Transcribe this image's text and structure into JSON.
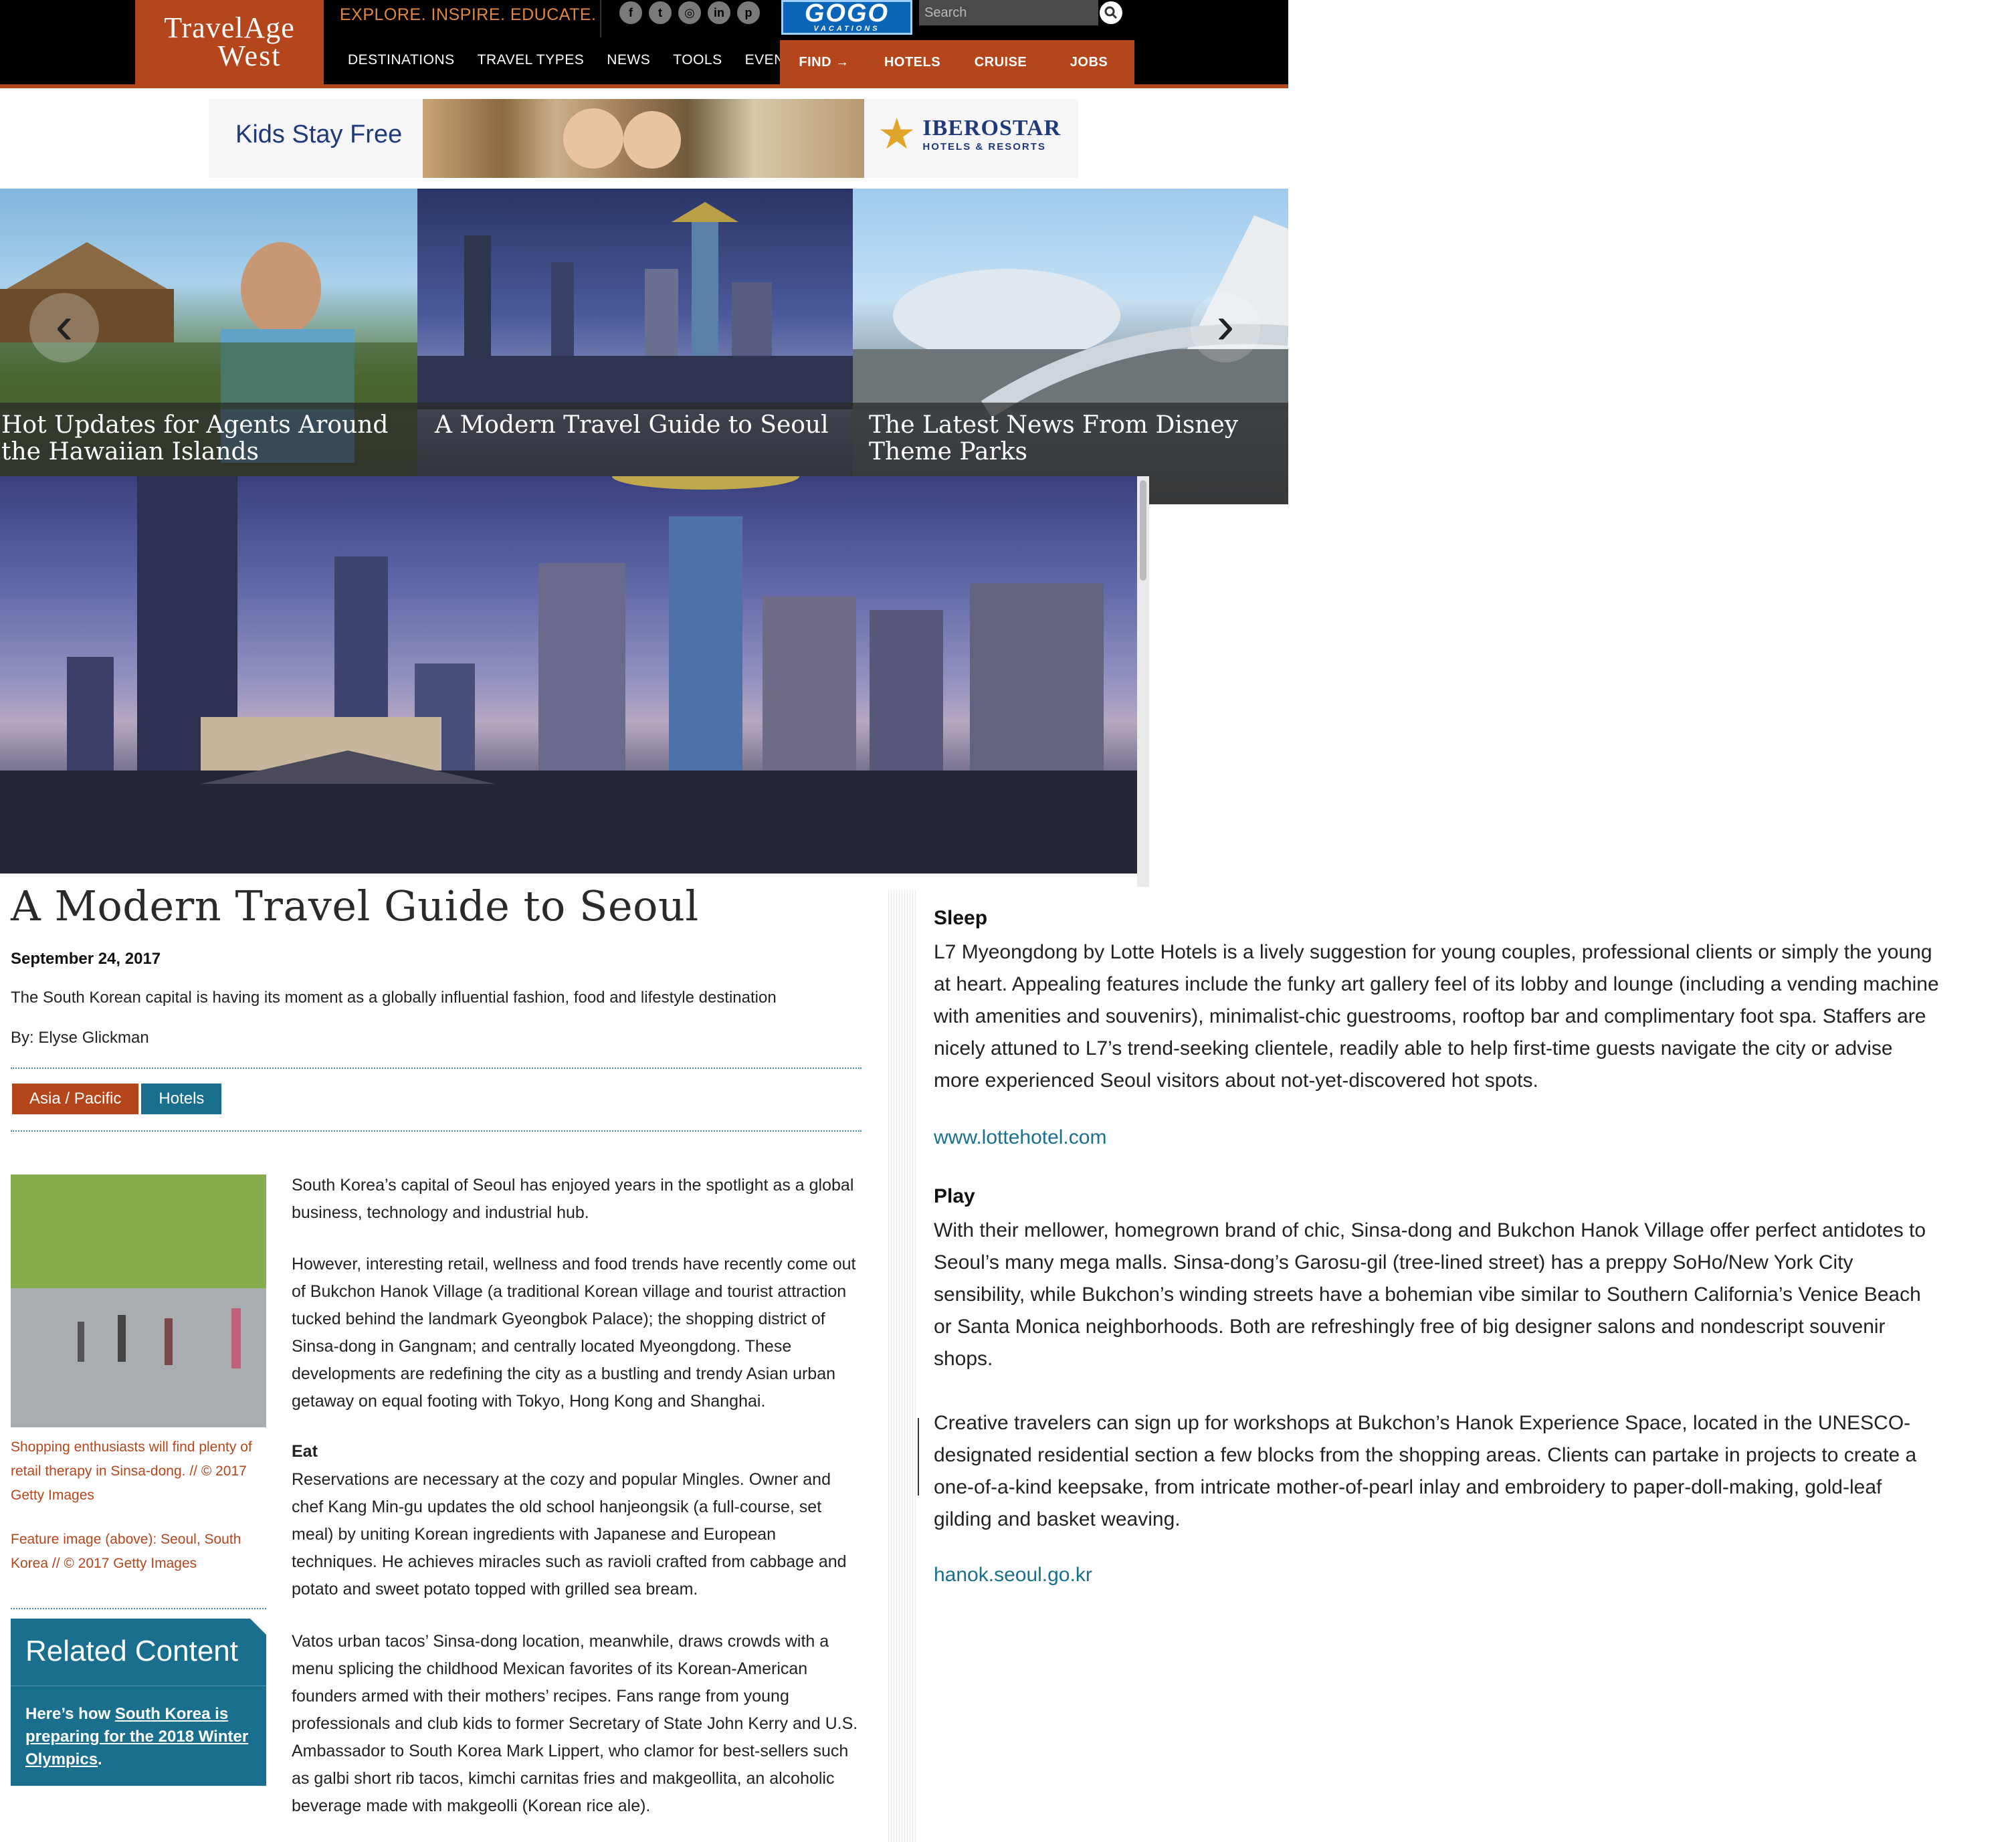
{
  "header": {
    "logo_line1": "TravelAge",
    "logo_line2": "West",
    "tagline": "EXPLORE. INSPIRE. EDUCATE.",
    "social": [
      {
        "icon": "facebook-icon",
        "glyph": "f"
      },
      {
        "icon": "twitter-icon",
        "glyph": "t"
      },
      {
        "icon": "instagram-icon",
        "glyph": "◎"
      },
      {
        "icon": "linkedin-icon",
        "glyph": "in"
      },
      {
        "icon": "pinterest-icon",
        "glyph": "p"
      }
    ],
    "nav": [
      "DESTINATIONS",
      "TRAVEL TYPES",
      "NEWS",
      "TOOLS",
      "EVENTS"
    ],
    "sponsor_line1": "GOGO",
    "sponsor_line2": "VACATIONS",
    "search_placeholder": "Search",
    "find": [
      "FIND →",
      "HOTELS",
      "CRUISE",
      "JOBS"
    ],
    "accent_color": "#b5451b"
  },
  "ad": {
    "headline": "Kids Stay Free",
    "brand": "IBEROSTAR",
    "brand_sub": "HOTELS & RESORTS"
  },
  "carousel": {
    "slides": [
      {
        "title": "Hot Updates for Agents Around the Hawaiian Islands"
      },
      {
        "title": "A Modern Travel Guide to Seoul"
      },
      {
        "title": "The Latest News From Disney Theme Parks"
      }
    ],
    "prev_icon": "chevron-left-icon",
    "next_icon": "chevron-right-icon"
  },
  "article": {
    "title": "A Modern Travel Guide to Seoul",
    "date": "September 24, 2017",
    "subtitle": "The South Korean capital is having its moment as a globally influential fashion, food and lifestyle destination",
    "byline": "By: Elyse Glickman",
    "tags": [
      "Asia / Pacific",
      "Hotels"
    ],
    "photo_caption": "Shopping enthusiasts will find plenty of retail therapy in Sinsa-dong. // © 2017 Getty Images",
    "feature_caption": "Feature image (above): Seoul, South Korea // © 2017 Getty Images",
    "related": {
      "heading": "Related Content",
      "prefix": "Here’s how ",
      "link": "South Korea is preparing for the 2018 Winter Olympics",
      "suffix": "."
    },
    "paragraphs": {
      "p1": "South Korea’s capital of Seoul has enjoyed years in the spotlight as a global business, technology and industrial hub.",
      "p2": "However, interesting retail, wellness and food trends have recently come out of Bukchon Hanok Village (a traditional Korean village and tourist attraction tucked behind the landmark Gyeongbok Palace); the shopping district of Sinsa-dong in Gangnam; and centrally located Myeongdong. These developments are redefining the city as a bustling and trendy Asian urban getaway on equal footing with Tokyo, Hong Kong and Shanghai.",
      "eat_head": "Eat",
      "eat1": "Reservations are necessary at the cozy and popular Mingles. Owner and chef Kang Min-gu updates the old school hanjeongsik (a full-course, set meal) by uniting Korean ingredients with Japanese and European techniques. He achieves miracles such as ravioli crafted from cabbage and potato and sweet potato topped with grilled sea bream.",
      "eat2": "Vatos urban tacos’ Sinsa-dong location, meanwhile, draws crowds with a menu splicing the childhood Mexican favorites of its Korean-American founders armed with their mothers’ recipes. Fans range from young professionals and club kids to former Secretary of State John Kerry and U.S. Ambassador to South Korea Mark Lippert, who clamor for best-sellers such as galbi short rib tacos, kimchi carnitas fries and makgeollita, an alcoholic beverage made with makgeolli (Korean rice ale)."
    },
    "right": {
      "sleep_head": "Sleep",
      "sleep": "L7 Myeongdong by Lotte Hotels is a lively suggestion for young couples, professional clients or simply the young at heart. Appealing features include the funky art gallery feel of its lobby and lounge (including a vending machine with amenities and souvenirs), minimalist-chic guestrooms, rooftop bar and complimentary foot spa. Staffers are nicely attuned to L7’s trend-seeking clientele, readily able to help first-time guests navigate the city or advise more experienced Seoul visitors about not-yet-discovered hot spots.",
      "sleep_link": "www.lottehotel.com",
      "play_head": "Play",
      "play": "With their mellower, homegrown brand of chic, Sinsa-dong and Bukchon Hanok Village offer perfect antidotes to Seoul’s many mega malls. Sinsa-dong’s Garosu-gil (tree-lined street) has a preppy SoHo/New York City sensibility, while Bukchon’s winding streets have a bohemian vibe similar to Southern California’s Venice Beach or Santa Monica neighborhoods. Both are refreshingly free of big designer salons and nondescript souvenir shops.",
      "play2": "Creative travelers can sign up for workshops at Bukchon’s Hanok Experience Space, located in the UNESCO-designated residential section a few blocks from the shopping areas. Clients can partake in projects to create a one-of-a-kind keepsake, from intricate mother-of-pearl inlay and embroidery to paper-doll-making, gold-leaf gilding and basket weaving.",
      "play_link": "hanok.seoul.go.kr"
    }
  }
}
